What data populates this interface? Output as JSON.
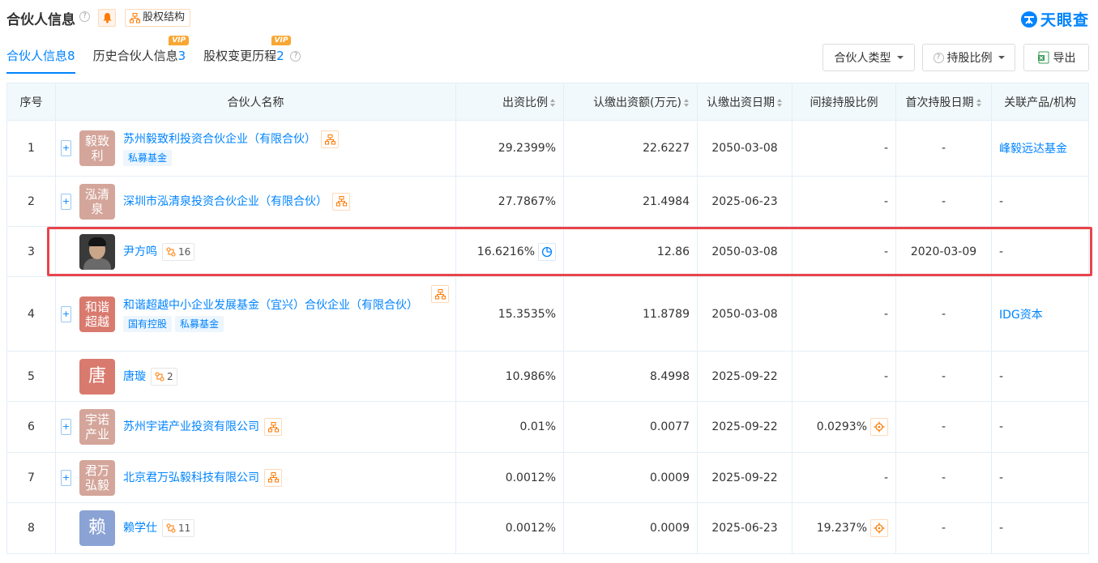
{
  "header": {
    "title": "合伙人信息",
    "equity_label": "股权结构",
    "logo_text": "天眼查"
  },
  "tabs": [
    {
      "label": "合伙人信息",
      "count": "8",
      "vip": ""
    },
    {
      "label": "历史合伙人信息",
      "count": "3",
      "vip": "VIP"
    },
    {
      "label": "股权变更历程",
      "count": "2",
      "vip": "VIP"
    }
  ],
  "tools": {
    "partner_type": "合伙人类型",
    "share_ratio": "持股比例",
    "export": "导出"
  },
  "columns": [
    "序号",
    "合伙人名称",
    "出资比例",
    "认缴出资额(万元)",
    "认缴出资日期",
    "间接持股比例",
    "首次持股日期",
    "关联产品/机构"
  ],
  "rows": [
    {
      "index": "1",
      "avatar": "毅致利",
      "avatar_color": "#d4a59a",
      "name": "苏州毅致利投资合伙企业（有限合伙）",
      "tags": [
        "私募基金"
      ],
      "rel_count": "",
      "ratio": "29.2399%",
      "amount": "22.6227",
      "date": "2050-03-08",
      "indirect": "-",
      "first_date": "-",
      "related": "峰毅远达基金"
    },
    {
      "index": "2",
      "avatar": "泓清泉",
      "avatar_color": "#d4a59a",
      "name": "深圳市泓清泉投资合伙企业（有限合伙）",
      "tags": [],
      "rel_count": "",
      "ratio": "27.7867%",
      "amount": "21.4984",
      "date": "2025-06-23",
      "indirect": "-",
      "first_date": "-",
      "related": "-"
    },
    {
      "index": "3",
      "avatar": "",
      "avatar_color": "",
      "name": "尹方鸣",
      "tags": [],
      "rel_count": "16",
      "ratio": "16.6216%",
      "amount": "12.86",
      "date": "2050-03-08",
      "indirect": "-",
      "first_date": "2020-03-09",
      "related": "-"
    },
    {
      "index": "4",
      "avatar": "和谐超越",
      "avatar_color": "#d97a6e",
      "name": "和谐超越中小企业发展基金（宜兴）合伙企业（有限合伙）",
      "tags": [
        "国有控股",
        "私募基金"
      ],
      "rel_count": "",
      "ratio": "15.3535%",
      "amount": "11.8789",
      "date": "2050-03-08",
      "indirect": "-",
      "first_date": "-",
      "related": "IDG资本"
    },
    {
      "index": "5",
      "avatar": "唐",
      "avatar_color": "#d97a6e",
      "name": "唐璇",
      "tags": [],
      "rel_count": "2",
      "ratio": "10.986%",
      "amount": "8.4998",
      "date": "2025-09-22",
      "indirect": "-",
      "first_date": "-",
      "related": "-"
    },
    {
      "index": "6",
      "avatar": "宇诺产业",
      "avatar_color": "#d4a59a",
      "name": "苏州宇诺产业投资有限公司",
      "tags": [],
      "rel_count": "",
      "ratio": "0.01%",
      "amount": "0.0077",
      "date": "2025-09-22",
      "indirect": "0.0293%",
      "first_date": "-",
      "related": "-"
    },
    {
      "index": "7",
      "avatar": "君万弘毅",
      "avatar_color": "#d4a59a",
      "name": "北京君万弘毅科技有限公司",
      "tags": [],
      "rel_count": "",
      "ratio": "0.0012%",
      "amount": "0.0009",
      "date": "2025-09-22",
      "indirect": "-",
      "first_date": "-",
      "related": "-"
    },
    {
      "index": "8",
      "avatar": "赖",
      "avatar_color": "#8ba3d4",
      "name": "赖学仕",
      "tags": [],
      "rel_count": "11",
      "ratio": "0.0012%",
      "amount": "0.0009",
      "date": "2025-06-23",
      "indirect": "19.237%",
      "first_date": "-",
      "related": "-"
    }
  ]
}
